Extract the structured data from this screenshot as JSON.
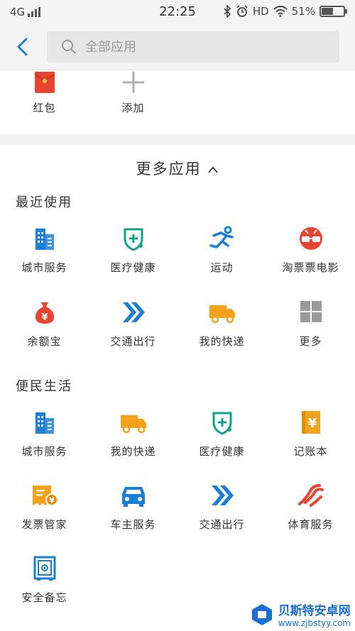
{
  "status_bar": {
    "network": "4G",
    "time": "22:25",
    "hd": "HD",
    "battery": "51%",
    "battery_level": 0.51
  },
  "search": {
    "placeholder": "全部应用"
  },
  "top_apps": [
    {
      "label": "红包",
      "icon": "red-envelope-icon"
    },
    {
      "label": "添加",
      "icon": "plus-icon"
    }
  ],
  "more_apps_title": "更多应用",
  "recent": {
    "title": "最近使用",
    "items": [
      {
        "label": "城市服务",
        "icon": "building-icon"
      },
      {
        "label": "医疗健康",
        "icon": "medical-shield-icon"
      },
      {
        "label": "运动",
        "icon": "running-icon"
      },
      {
        "label": "淘票票电影",
        "icon": "movie-glasses-icon"
      },
      {
        "label": "余额宝",
        "icon": "money-bag-icon"
      },
      {
        "label": "交通出行",
        "icon": "double-arrow-icon"
      },
      {
        "label": "我的快递",
        "icon": "truck-icon"
      },
      {
        "label": "更多",
        "icon": "grid-more-icon"
      }
    ]
  },
  "life": {
    "title": "便民生活",
    "items": [
      {
        "label": "城市服务",
        "icon": "building-icon"
      },
      {
        "label": "我的快递",
        "icon": "truck-icon"
      },
      {
        "label": "医疗健康",
        "icon": "medical-shield-icon"
      },
      {
        "label": "记账本",
        "icon": "ledger-icon"
      },
      {
        "label": "发票管家",
        "icon": "invoice-icon"
      },
      {
        "label": "车主服务",
        "icon": "car-icon"
      },
      {
        "label": "交通出行",
        "icon": "double-arrow-icon"
      },
      {
        "label": "体育服务",
        "icon": "sports-icon"
      },
      {
        "label": "安全备忘",
        "icon": "safe-icon"
      }
    ]
  },
  "watermark": {
    "line1": "贝斯特安卓网",
    "line2": "www.zjbstyy.com"
  },
  "colors": {
    "blue": "#1b7fd6",
    "teal": "#12a38e",
    "orange": "#f2a21b",
    "red": "#e8442f",
    "gray": "#9a9a9a"
  }
}
